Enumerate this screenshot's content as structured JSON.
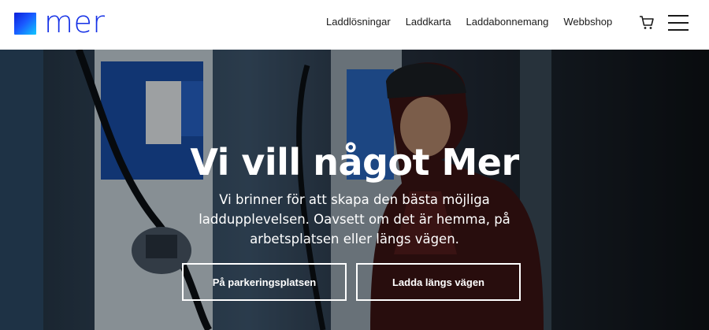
{
  "header": {
    "logo_text": "mer",
    "nav": [
      "Laddlösningar",
      "Laddkarta",
      "Laddabonnemang",
      "Webbshop"
    ]
  },
  "hero": {
    "title": "Vi vill något Mer",
    "subtitle": "Vi brinner för att skapa den bästa möjliga laddupplevelsen. Oavsett om det är hemma, på arbetsplatsen eller längs vägen.",
    "buttons": [
      "På parkeringsplatsen",
      "Ladda längs vägen"
    ]
  },
  "colors": {
    "brand": "#1430e6",
    "overlay": "#000000",
    "text_on_hero": "#ffffff"
  },
  "icons": {
    "cart": "cart-icon",
    "menu": "menu-icon",
    "logo": "logo-mark-icon"
  }
}
